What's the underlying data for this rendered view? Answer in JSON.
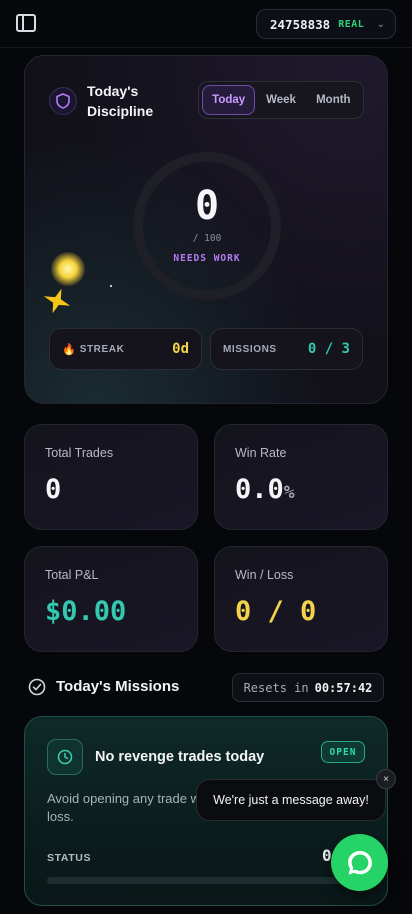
{
  "topbar": {
    "account_id": "24758838",
    "account_mode": "REAL",
    "chevron": "⌄"
  },
  "discipline": {
    "title": "Today's Discipline",
    "tabs": [
      {
        "label": "Today",
        "active": true
      },
      {
        "label": "Week",
        "active": false
      },
      {
        "label": "Month",
        "active": false
      }
    ],
    "score": "0",
    "score_max": "/ 100",
    "status": "NEEDS WORK",
    "score_fraction": 0,
    "streak_label": "STREAK",
    "streak_value": "0d",
    "missions_label": "MISSIONS",
    "missions_value": "0 / 3"
  },
  "stats": {
    "total_trades": {
      "label": "Total Trades",
      "value": "0"
    },
    "win_rate": {
      "label": "Win Rate",
      "value": "0.0",
      "unit": "%"
    },
    "total_pnl": {
      "label": "Total P&L",
      "value": "$0.00"
    },
    "win_loss": {
      "label": "Win / Loss",
      "value": "0 / 0"
    }
  },
  "missions": {
    "title": "Today's Missions",
    "reset_label": "Resets in",
    "reset_time": "00:57:42",
    "items": [
      {
        "name": "No revenge trades today",
        "badge": "OPEN",
        "description": "Avoid opening any trade w loss.",
        "status_label": "STATUS",
        "status_value": "0",
        "progress": 0
      }
    ]
  },
  "chat": {
    "message": "We're just a message away!",
    "close": "×"
  },
  "colors": {
    "accent_purple": "#b57cf2",
    "accent_green": "#2fd27b",
    "teal": "#33c9b0",
    "yellow": "#f2d34b",
    "whatsapp": "#25d366"
  }
}
